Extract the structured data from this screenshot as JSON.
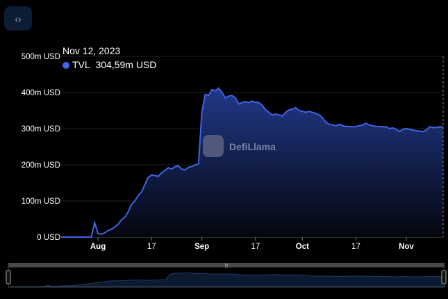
{
  "embed_button": {
    "icon": "code-icon",
    "glyph": "‹›"
  },
  "tooltip": {
    "date": "Nov 12, 2023",
    "series": "TVL",
    "value": "304,59m USD"
  },
  "watermark": "DefiLlama",
  "colors": {
    "line": "#3f64e4",
    "fill_top": "#22388a",
    "fill_bottom": "#04060e",
    "grid": "#1f1f1f",
    "brush_fill": "#0b1a30",
    "brush_bar": "#4a4a4a"
  },
  "chart_data": {
    "type": "area",
    "title": "",
    "xlabel": "",
    "ylabel": "",
    "series_name": "TVL",
    "start_date": "2023-07-21",
    "end_date": "2023-11-12",
    "unit": "m USD",
    "ylim": [
      0,
      500
    ],
    "y_ticks": [
      {
        "value": 0,
        "label": "0 USD"
      },
      {
        "value": 100,
        "label": "100m USD"
      },
      {
        "value": 200,
        "label": "200m USD"
      },
      {
        "value": 300,
        "label": "300m USD"
      },
      {
        "value": 400,
        "label": "400m USD"
      },
      {
        "value": 500,
        "label": "500m USD"
      }
    ],
    "x_ticks": [
      {
        "day_index": 11,
        "label": "Aug",
        "bold": true
      },
      {
        "day_index": 27,
        "label": "17",
        "bold": false
      },
      {
        "day_index": 42,
        "label": "Sep",
        "bold": true
      },
      {
        "day_index": 58,
        "label": "17",
        "bold": false
      },
      {
        "day_index": 72,
        "label": "Oct",
        "bold": true
      },
      {
        "day_index": 88,
        "label": "17",
        "bold": false
      },
      {
        "day_index": 103,
        "label": "Nov",
        "bold": true
      }
    ],
    "grid": true,
    "values": [
      0,
      0,
      0,
      0,
      0,
      0,
      0,
      0,
      0,
      0,
      40,
      10,
      8,
      12,
      18,
      22,
      28,
      35,
      48,
      55,
      70,
      90,
      100,
      115,
      125,
      145,
      165,
      172,
      170,
      168,
      178,
      185,
      192,
      188,
      195,
      197,
      188,
      186,
      193,
      195,
      200,
      202,
      345,
      395,
      392,
      408,
      405,
      412,
      400,
      385,
      390,
      392,
      385,
      368,
      372,
      375,
      372,
      376,
      373,
      372,
      365,
      352,
      345,
      338,
      340,
      338,
      335,
      345,
      352,
      354,
      358,
      350,
      348,
      345,
      348,
      345,
      342,
      338,
      330,
      318,
      312,
      310,
      308,
      312,
      308,
      306,
      306,
      305,
      306,
      308,
      310,
      315,
      310,
      308,
      306,
      306,
      305,
      305,
      300,
      302,
      298,
      292,
      298,
      300,
      298,
      296,
      294,
      293,
      292,
      296,
      305,
      303,
      303,
      305,
      304.59
    ]
  }
}
